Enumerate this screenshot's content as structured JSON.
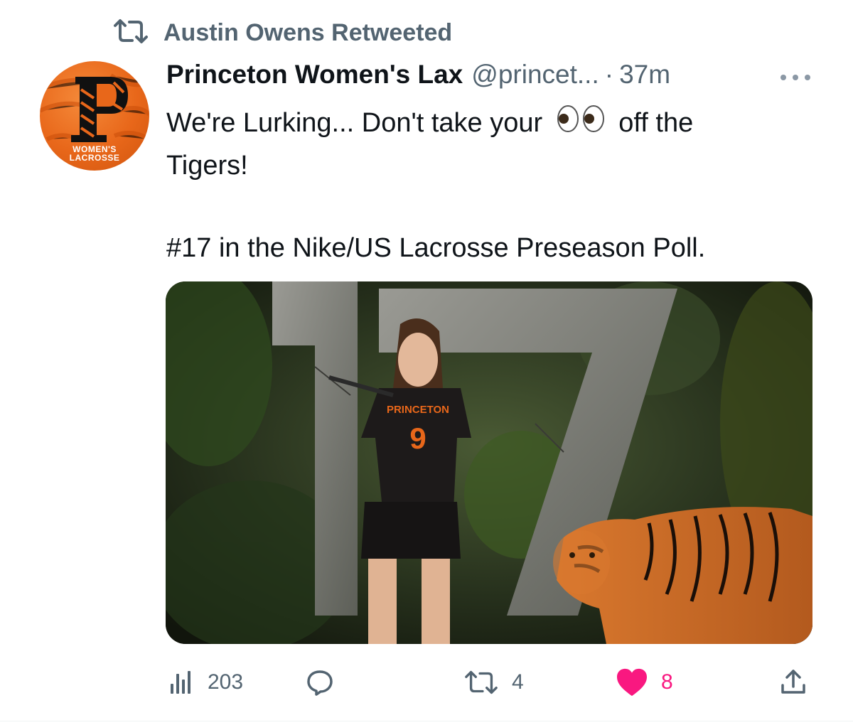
{
  "retweet_banner": {
    "text": "Austin Owens Retweeted",
    "icon": "retweet-icon"
  },
  "tweet": {
    "author": {
      "name": "Princeton Women's Lax",
      "handle": "@princet...",
      "time": "37m",
      "avatar": {
        "letter": "P",
        "caption_line1": "WOMEN'S",
        "caption_line2": "LACROSSE"
      }
    },
    "text": {
      "line1_before_emoji": "We're Lurking... Don't take your",
      "emoji": "eyes-emoji",
      "line1_after_emoji": "off the",
      "line2": "Tigers!",
      "line3": "#17 in the Nike/US Lacrosse Preseason Poll."
    },
    "media": {
      "jersey_text": "PRINCETON",
      "jersey_number": "9",
      "big_number": "17"
    },
    "actions": {
      "views": "203",
      "replies": "",
      "retweets": "4",
      "likes": "8"
    }
  },
  "colors": {
    "accent_like": "#f91880",
    "secondary_text": "#536471",
    "princeton_orange": "#e8671a"
  }
}
